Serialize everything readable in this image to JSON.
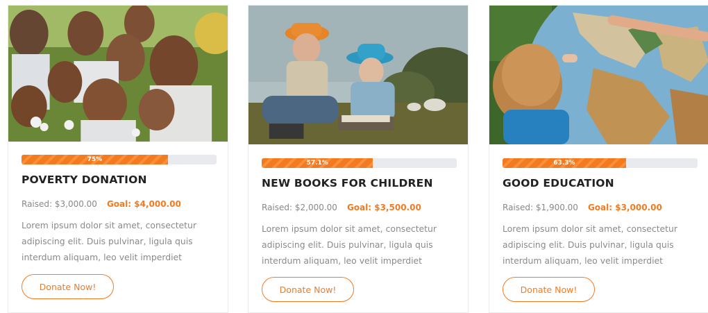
{
  "cards": [
    {
      "progress_pct": 75,
      "progress_label": "75%",
      "title": "POVERTY DONATION",
      "raised": "Raised: $3,000.00",
      "goal": "Goal: $4,000.00",
      "description": "Lorem ipsum dolor sit amet, consectetur adipiscing elit. Duis pulvinar, ligula quis interdum aliquam, leo velit imperdiet",
      "button": "Donate Now!"
    },
    {
      "progress_pct": 57.1,
      "progress_label": "57.1%",
      "title": "NEW BOOKS FOR CHILDREN",
      "raised": "Raised: $2,000.00",
      "goal": "Goal: $3,500.00",
      "description": "Lorem ipsum dolor sit amet, consectetur adipiscing elit. Duis pulvinar, ligula quis interdum aliquam, leo velit imperdiet",
      "button": "Donate Now!"
    },
    {
      "progress_pct": 63.3,
      "progress_label": "63.3%",
      "title": "GOOD EDUCATION",
      "raised": "Raised: $1,900.00",
      "goal": "Goal: $3,000.00",
      "description": "Lorem ipsum dolor sit amet, consectetur adipiscing elit. Duis pulvinar, ligula quis interdum aliquam, leo velit imperdiet",
      "button": "Donate Now!"
    }
  ],
  "colors": {
    "accent": "#f47a20",
    "track": "#e8eaed",
    "title": "#222222",
    "muted": "#8a8a8a"
  }
}
